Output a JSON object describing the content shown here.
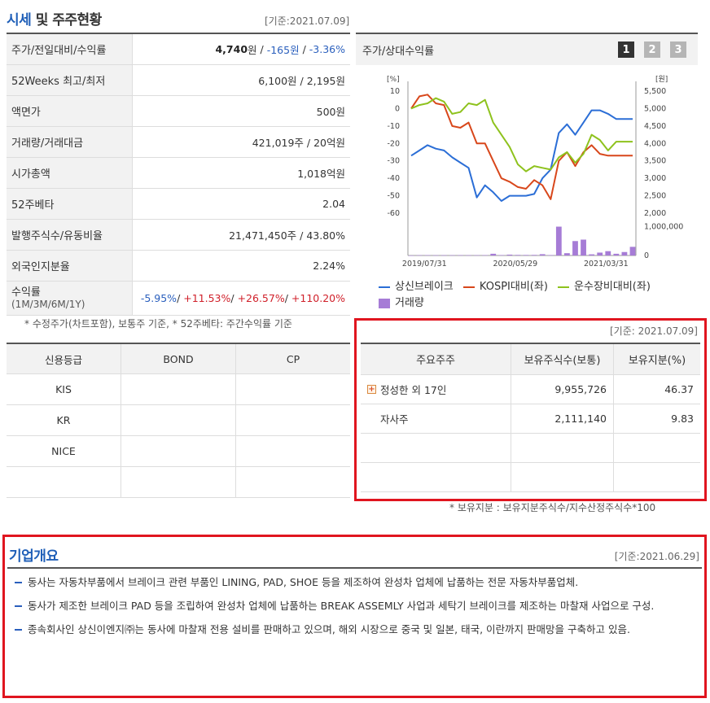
{
  "price_section": {
    "title_blue": "시세",
    "title_dark": " 및 주주현황",
    "base_date": "[기준:2021.07.09]",
    "rows": [
      {
        "label": "주가/전일대비/수익률",
        "price": "4,740",
        "unit": "원",
        "sep1": " / ",
        "change": "-165원",
        "sep2": " / ",
        "rate": "-3.36%"
      },
      {
        "label": "52Weeks 최고/최저",
        "value": "6,100원 / 2,195원"
      },
      {
        "label": "액면가",
        "value": "500원"
      },
      {
        "label": "거래량/거래대금",
        "value": "421,019주 / 20억원"
      },
      {
        "label": "시가총액",
        "value": "1,018억원"
      },
      {
        "label": "52주베타",
        "value": "2.04"
      },
      {
        "label": "발행주식수/유동비율",
        "value": "21,471,450주 / 43.80%"
      },
      {
        "label": "외국인지분율",
        "value": "2.24%"
      }
    ],
    "returns": {
      "label": "수익률",
      "sublabel": "(1M/3M/6M/1Y)",
      "r1": "-5.95%",
      "r2": "+11.53%",
      "r3": "+26.57%",
      "r4": "+110.20%",
      "slash": "/ "
    },
    "footnote": "* 수정주가(차트포함), 보통주 기준, * 52주베타: 주간수익률 기준"
  },
  "credit": {
    "headers": [
      "신용등급",
      "BOND",
      "CP"
    ],
    "rows": [
      "KIS",
      "KR",
      "NICE",
      ""
    ]
  },
  "chart_panel": {
    "title": "주가/상대수익률",
    "tabs": [
      "1",
      "2",
      "3"
    ],
    "active_tab": "1"
  },
  "chart_data": {
    "type": "line",
    "left_axis_unit": "[%]",
    "right_axis_unit": "[원]",
    "left_ticks": [
      "10",
      "0",
      "-10",
      "-20",
      "-30",
      "-40",
      "-50",
      "-60"
    ],
    "right_ticks": [
      "5,500",
      "5,000",
      "4,500",
      "4,000",
      "3,500",
      "3,000",
      "2,500",
      "2,000"
    ],
    "volume_ticks": [
      "1,000,000",
      "0"
    ],
    "x_ticks": [
      "2019/07/31",
      "2020/05/29",
      "2021/03/31"
    ],
    "left_range": [
      -60,
      10
    ],
    "right_range": [
      2000,
      5500
    ],
    "x_count": 28,
    "series": [
      {
        "name": "상신브레이크",
        "axis": "right",
        "color": "#2b6ed6",
        "values": [
          3650,
          3800,
          3950,
          3850,
          3800,
          3600,
          3450,
          3300,
          2450,
          2800,
          2600,
          2350,
          2500,
          2500,
          2500,
          2550,
          3000,
          3250,
          4300,
          4550,
          4250,
          4600,
          4950,
          4950,
          4850,
          4700,
          4700,
          4700
        ]
      },
      {
        "name": "KOSPI대비(좌)",
        "axis": "left",
        "color": "#d8471b",
        "values": [
          0,
          7,
          8,
          3,
          2,
          -10,
          -11,
          -8,
          -20,
          -20,
          -30,
          -40,
          -42,
          -45,
          -46,
          -41,
          -44,
          -52,
          -30,
          -25,
          -33,
          -25,
          -21,
          -26,
          -27,
          -27,
          -27,
          -27
        ]
      },
      {
        "name": "운수장비대비(좌)",
        "axis": "left",
        "color": "#8ec21d",
        "values": [
          0,
          2,
          3,
          6,
          4,
          -3,
          -2,
          3,
          2,
          5,
          -8,
          -15,
          -22,
          -32,
          -36,
          -33,
          -34,
          -35,
          -28,
          -25,
          -31,
          -26,
          -15,
          -18,
          -24,
          -19,
          -19,
          -19
        ]
      }
    ],
    "volume": {
      "name": "거래량",
      "color": "#a67cd6",
      "values": [
        0,
        10000,
        12000,
        8000,
        9000,
        10000,
        11000,
        9000,
        10000,
        12000,
        60000,
        15000,
        30000,
        20000,
        18000,
        20000,
        45000,
        15000,
        1000000,
        80000,
        500000,
        550000,
        40000,
        100000,
        150000,
        60000,
        120000,
        300000
      ]
    }
  },
  "legend": [
    "상신브레이크",
    "KOSPI대비(좌)",
    "운수장비대비(좌)",
    "거래량"
  ],
  "shareholders": {
    "base_date": "[기준: 2021.07.09]",
    "headers": [
      "주요주주",
      "보유주식수(보통)",
      "보유지분(%)"
    ],
    "rows": [
      {
        "name": "정성한 외 17인",
        "shares": "9,955,726",
        "pct": "46.37"
      },
      {
        "name": "자사주",
        "shares": "2,111,140",
        "pct": "9.83"
      }
    ],
    "footnote": "* 보유지분 : 보유지분주식수/지수산정주식수*100"
  },
  "overview": {
    "title": "기업개요",
    "base_date": "[기준:2021.06.29]",
    "items": [
      "동사는 자동차부품에서 브레이크 관련 부품인 LINING, PAD, SHOE 등을 제조하여 완성차 업체에 납품하는 전문 자동차부품업체.",
      "동사가 제조한 브레이크 PAD 등을 조립하여 완성차 업체에 납품하는 BREAK ASSEMLY 사업과 세탁기 브레이크를 제조하는 마찰재 사업으로 구성.",
      "종속회사인 상신이엔지㈜는 동사에 마찰재 전용 설비를 판매하고 있으며, 해외 시장으로 중국 및 일본, 태국, 이란까지 판매망을 구축하고 있음."
    ]
  }
}
